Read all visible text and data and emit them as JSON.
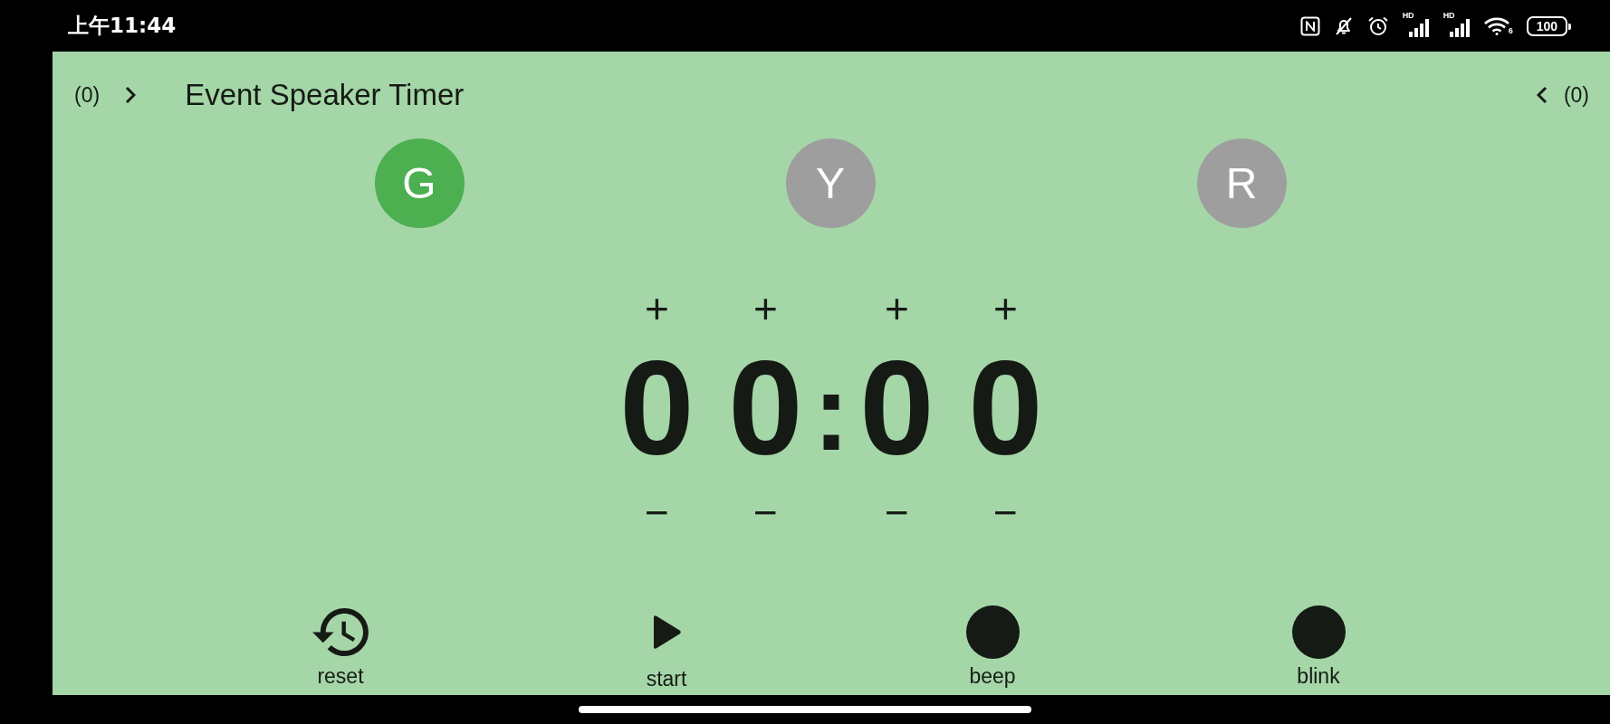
{
  "status_bar": {
    "time": "上午11:44",
    "signals": [
      {
        "label": "HD"
      },
      {
        "label": "HD"
      }
    ],
    "wifi_label": "6",
    "battery": "100"
  },
  "header": {
    "left_count": "(0)",
    "title": "Event Speaker Timer",
    "right_count": "(0)"
  },
  "lights": [
    {
      "label": "G",
      "color": "#4caf50"
    },
    {
      "label": "Y",
      "color": "#9e9e9e"
    },
    {
      "label": "R",
      "color": "#9e9e9e"
    }
  ],
  "timer": {
    "minutes": [
      {
        "plus": "+",
        "value": "0",
        "minus": "−"
      },
      {
        "plus": "+",
        "value": "0",
        "minus": "−"
      }
    ],
    "separator": ":",
    "seconds": [
      {
        "plus": "+",
        "value": "0",
        "minus": "−"
      },
      {
        "plus": "+",
        "value": "0",
        "minus": "−"
      }
    ]
  },
  "controls": [
    {
      "kind": "reset",
      "label": "reset"
    },
    {
      "kind": "play",
      "label": "start"
    },
    {
      "kind": "toggle",
      "label": "beep"
    },
    {
      "kind": "toggle",
      "label": "blink"
    }
  ]
}
